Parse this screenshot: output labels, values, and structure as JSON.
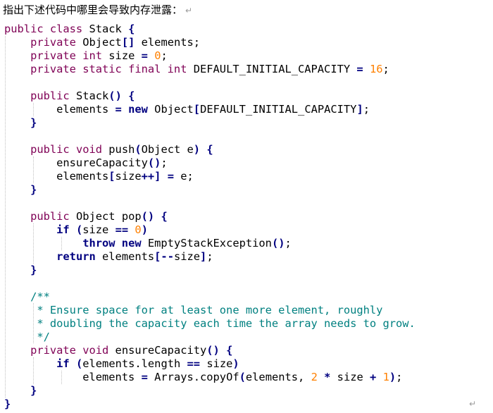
{
  "question": "指出下述代码中哪里会导致内存泄露：",
  "return_mark": "↵",
  "code": {
    "lines": [
      [
        [
          "k",
          "public class"
        ],
        [
          "p",
          " Stack "
        ],
        [
          "kb",
          "{"
        ]
      ],
      [
        [
          "p",
          "    "
        ],
        [
          "k",
          "private"
        ],
        [
          "p",
          " Object"
        ],
        [
          "kb",
          "[]"
        ],
        [
          "p",
          " elements;"
        ]
      ],
      [
        [
          "p",
          "    "
        ],
        [
          "k",
          "private int"
        ],
        [
          "p",
          " size "
        ],
        [
          "kb",
          "="
        ],
        [
          "p",
          " "
        ],
        [
          "n",
          "0"
        ],
        [
          "p",
          ";"
        ]
      ],
      [
        [
          "p",
          "    "
        ],
        [
          "k",
          "private static final int"
        ],
        [
          "p",
          " DEFAULT_INITIAL_CAPACITY "
        ],
        [
          "kb",
          "="
        ],
        [
          "p",
          " "
        ],
        [
          "n",
          "16"
        ],
        [
          "p",
          ";"
        ]
      ],
      [
        [
          "p",
          ""
        ]
      ],
      [
        [
          "p",
          "    "
        ],
        [
          "k",
          "public"
        ],
        [
          "p",
          " Stack"
        ],
        [
          "kb",
          "()"
        ],
        [
          "p",
          " "
        ],
        [
          "kb",
          "{"
        ]
      ],
      [
        [
          "p",
          "        elements "
        ],
        [
          "kb",
          "="
        ],
        [
          "p",
          " "
        ],
        [
          "kb",
          "new"
        ],
        [
          "p",
          " Object"
        ],
        [
          "kb",
          "["
        ],
        [
          "p",
          "DEFAULT_INITIAL_CAPACITY"
        ],
        [
          "kb",
          "]"
        ],
        [
          "p",
          ";"
        ]
      ],
      [
        [
          "p",
          "    "
        ],
        [
          "kb",
          "}"
        ]
      ],
      [
        [
          "p",
          ""
        ]
      ],
      [
        [
          "p",
          "    "
        ],
        [
          "k",
          "public void"
        ],
        [
          "p",
          " push"
        ],
        [
          "kb",
          "("
        ],
        [
          "p",
          "Object e"
        ],
        [
          "kb",
          ")"
        ],
        [
          "p",
          " "
        ],
        [
          "kb",
          "{"
        ]
      ],
      [
        [
          "p",
          "        ensureCapacity"
        ],
        [
          "kb",
          "()"
        ],
        [
          "p",
          ";"
        ]
      ],
      [
        [
          "p",
          "        elements"
        ],
        [
          "kb",
          "["
        ],
        [
          "p",
          "size"
        ],
        [
          "kb",
          "++]"
        ],
        [
          "p",
          " "
        ],
        [
          "kb",
          "="
        ],
        [
          "p",
          " e;"
        ]
      ],
      [
        [
          "p",
          "    "
        ],
        [
          "kb",
          "}"
        ]
      ],
      [
        [
          "p",
          ""
        ]
      ],
      [
        [
          "p",
          "    "
        ],
        [
          "k",
          "public"
        ],
        [
          "p",
          " Object pop"
        ],
        [
          "kb",
          "()"
        ],
        [
          "p",
          " "
        ],
        [
          "kb",
          "{"
        ]
      ],
      [
        [
          "p",
          "        "
        ],
        [
          "kb",
          "if"
        ],
        [
          "p",
          " "
        ],
        [
          "kb",
          "("
        ],
        [
          "p",
          "size "
        ],
        [
          "kb",
          "=="
        ],
        [
          "p",
          " "
        ],
        [
          "n",
          "0"
        ],
        [
          "kb",
          ")"
        ]
      ],
      [
        [
          "p",
          "            "
        ],
        [
          "kb",
          "throw new"
        ],
        [
          "p",
          " EmptyStackException"
        ],
        [
          "kb",
          "()"
        ],
        [
          "p",
          ";"
        ]
      ],
      [
        [
          "p",
          "        "
        ],
        [
          "kb",
          "return"
        ],
        [
          "p",
          " elements"
        ],
        [
          "kb",
          "[--"
        ],
        [
          "p",
          "size"
        ],
        [
          "kb",
          "]"
        ],
        [
          "p",
          ";"
        ]
      ],
      [
        [
          "p",
          "    "
        ],
        [
          "kb",
          "}"
        ]
      ],
      [
        [
          "p",
          ""
        ]
      ],
      [
        [
          "p",
          "    "
        ],
        [
          "c",
          "/**"
        ]
      ],
      [
        [
          "p",
          "    "
        ],
        [
          "c",
          " * Ensure space for at least one more element, roughly"
        ]
      ],
      [
        [
          "p",
          "    "
        ],
        [
          "c",
          " * doubling the capacity each time the array needs to grow."
        ]
      ],
      [
        [
          "p",
          "    "
        ],
        [
          "c",
          " */"
        ]
      ],
      [
        [
          "p",
          "    "
        ],
        [
          "k",
          "private void"
        ],
        [
          "p",
          " ensureCapacity"
        ],
        [
          "kb",
          "()"
        ],
        [
          "p",
          " "
        ],
        [
          "kb",
          "{"
        ]
      ],
      [
        [
          "p",
          "        "
        ],
        [
          "kb",
          "if"
        ],
        [
          "p",
          " "
        ],
        [
          "kb",
          "("
        ],
        [
          "p",
          "elements.length "
        ],
        [
          "kb",
          "=="
        ],
        [
          "p",
          " size"
        ],
        [
          "kb",
          ")"
        ]
      ],
      [
        [
          "p",
          "            elements "
        ],
        [
          "kb",
          "="
        ],
        [
          "p",
          " Arrays.copyOf"
        ],
        [
          "kb",
          "("
        ],
        [
          "p",
          "elements, "
        ],
        [
          "n",
          "2"
        ],
        [
          "p",
          " "
        ],
        [
          "kb",
          "*"
        ],
        [
          "p",
          " size "
        ],
        [
          "kb",
          "+"
        ],
        [
          "p",
          " "
        ],
        [
          "n",
          "1"
        ],
        [
          "kb",
          ")"
        ],
        [
          "p",
          ";"
        ]
      ],
      [
        [
          "p",
          "    "
        ],
        [
          "kb",
          "}"
        ]
      ],
      [
        [
          "kb",
          "}"
        ]
      ]
    ]
  }
}
